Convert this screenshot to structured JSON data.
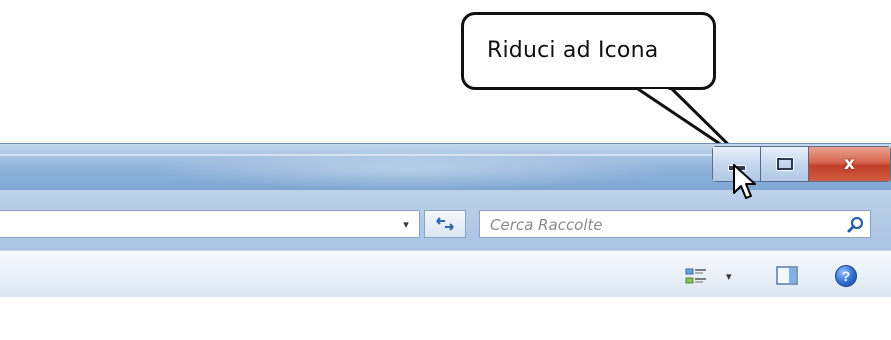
{
  "callout": {
    "text": "Riduci ad Icona"
  },
  "window": {
    "caption_buttons": {
      "minimize_glyph": "–",
      "maximize_glyph": "□",
      "close_glyph": "x"
    }
  },
  "address_bar": {
    "dropdown_glyph": "▾",
    "refresh_glyph": "↹"
  },
  "search": {
    "placeholder": "Cerca Raccolte"
  },
  "toolbar": {
    "views_dropdown_glyph": "▾",
    "help_glyph": "?"
  },
  "colors": {
    "title_bar": "#8fb2da",
    "close_button": "#c1402a",
    "accent": "#2a68b5"
  }
}
